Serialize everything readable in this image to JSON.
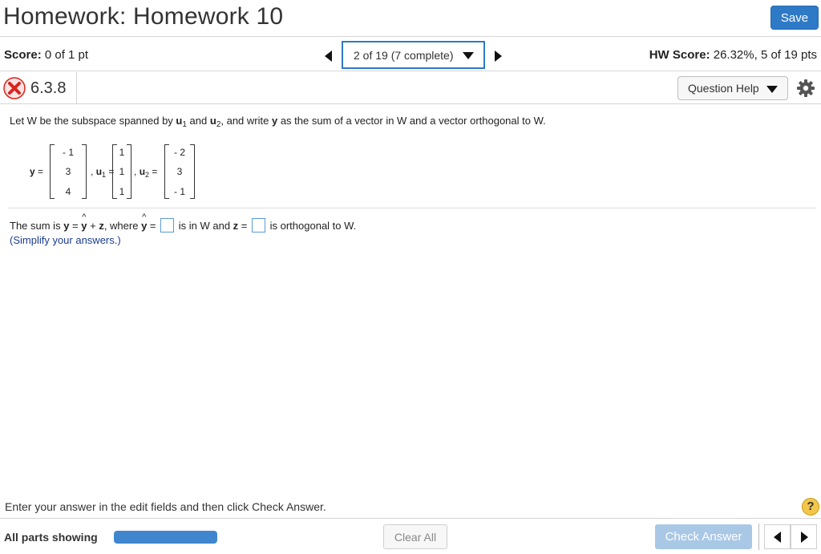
{
  "header": {
    "title": "Homework: Homework 10",
    "save_label": "Save"
  },
  "scorebar": {
    "score_label": "Score:",
    "score_value": "0 of 1 pt",
    "nav_selector": "2 of 19 (7 complete)",
    "hw_score_label": "HW Score:",
    "hw_score_value": "26.32%, 5 of 19 pts"
  },
  "question": {
    "number": "6.3.8",
    "status_icon": "red-x-icon",
    "help_label": "Question Help",
    "settings_icon": "gear-icon",
    "prompt": {
      "p1": "Let W be the subspace spanned by ",
      "u1": "u",
      "u1_sub": "1",
      "p2": " and ",
      "u2": "u",
      "u2_sub": "2",
      "p3": ", and write ",
      "y": "y",
      "p4": " as the sum of a vector in W and a vector orthogonal to W."
    },
    "matrices": {
      "y_label": "y",
      "u1_label": "u",
      "u1_sub": "1",
      "u2_label": "u",
      "u2_sub": "2",
      "eq": "=",
      "comma": ",",
      "y_values": [
        "- 1",
        "3",
        "4"
      ],
      "u1_values": [
        "1",
        "1",
        "1"
      ],
      "u2_values": [
        "- 2",
        "3",
        "- 1"
      ]
    },
    "sum": {
      "p1": "The sum is ",
      "y": "y",
      "eq": " = ",
      "yhat": "y",
      "plus": " + ",
      "z": "z",
      "p2": ", where ",
      "yhat2": "y",
      "eq2": " = ",
      "p3": "is in W and ",
      "z2": "z",
      "eq3": " = ",
      "p4": "is orthogonal to W."
    },
    "simplify": "(Simplify your answers.)"
  },
  "instructions": "Enter your answer in the edit fields and then click Check Answer.",
  "help_icon": "?",
  "footer": {
    "parts_label": "All parts showing",
    "progress_fraction": 1.0,
    "clear_all": "Clear All",
    "check_answer": "Check Answer"
  },
  "colors": {
    "accent": "#2e7ac7",
    "error": "#d9241c",
    "check_answer_disabled": "#a9c8e6",
    "help_icon": "#f2c74a"
  }
}
